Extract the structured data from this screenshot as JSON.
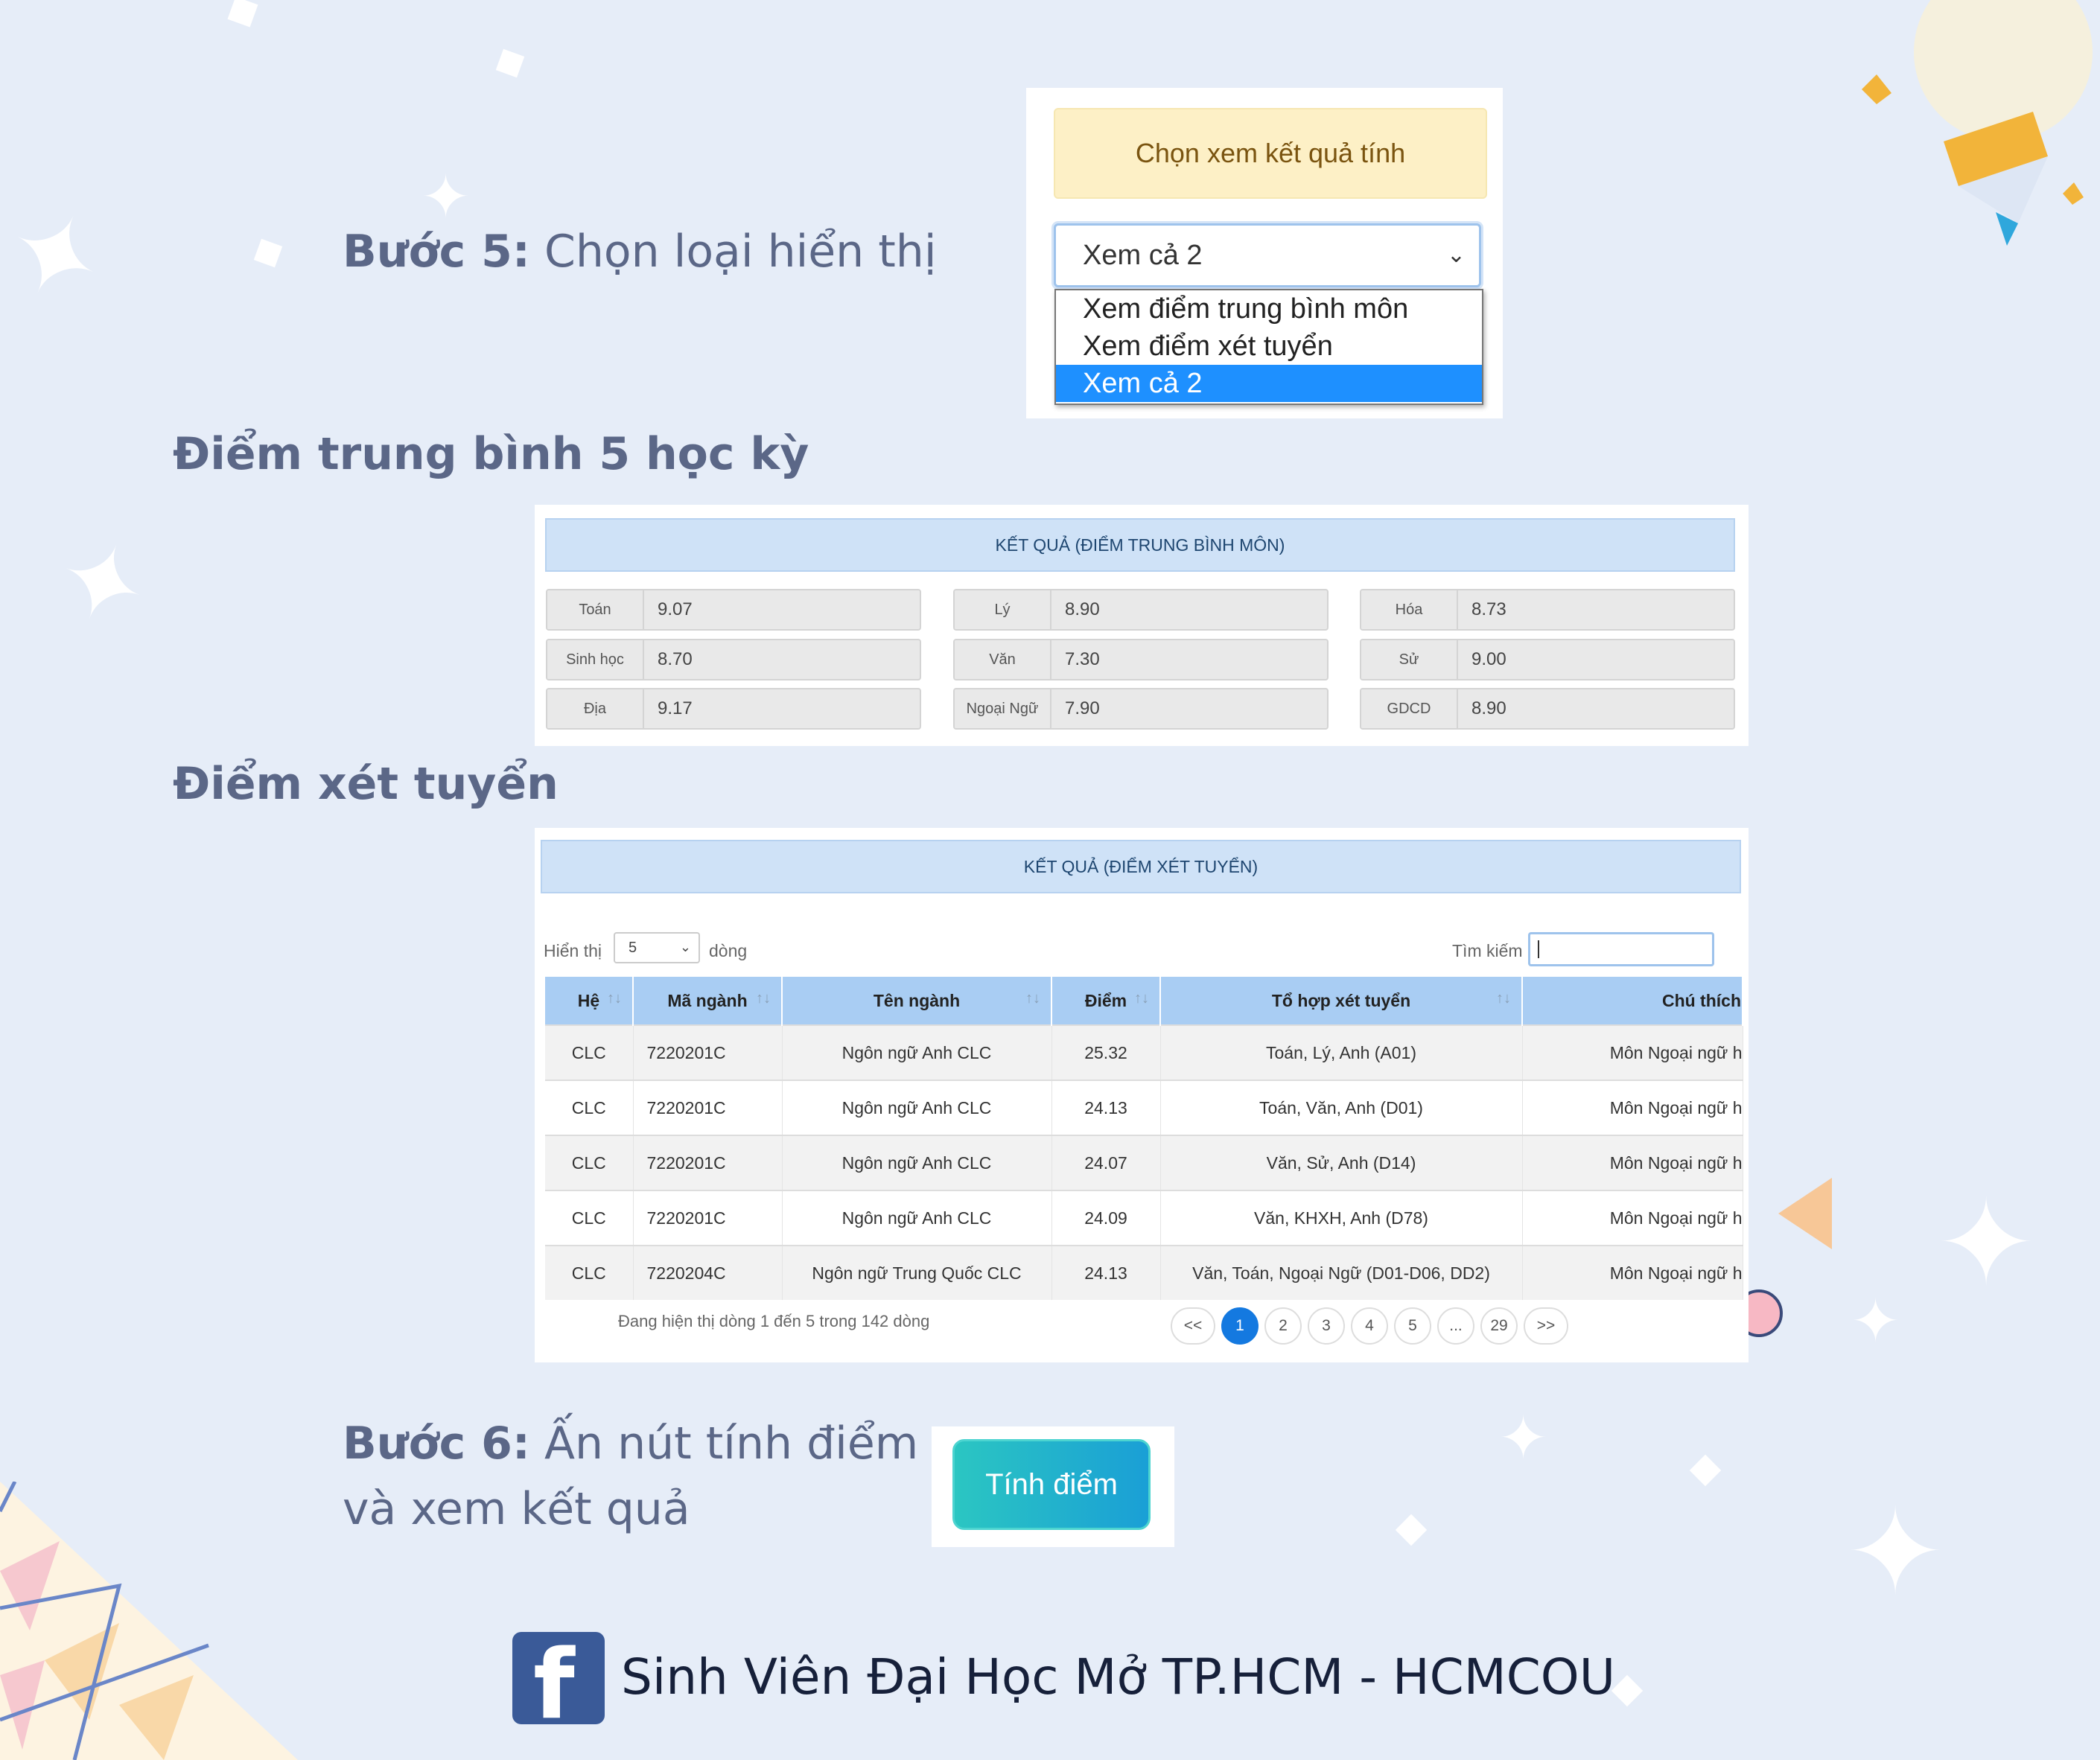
{
  "step5": {
    "label_bold": "Bước 5:",
    "label_rest": " Chọn loại hiển thị",
    "choose_button": "Chọn xem kết quả tính",
    "select_value": "Xem cả 2",
    "options": [
      "Xem điểm trung bình môn",
      "Xem điểm xét tuyển",
      "Xem cả 2"
    ]
  },
  "gpa": {
    "section_title": "Điểm trung bình 5 học kỳ",
    "header": "KẾT QUẢ (ĐIỂM TRUNG BÌNH MÔN)",
    "cells": [
      {
        "label": "Toán",
        "value": "9.07"
      },
      {
        "label": "Lý",
        "value": "8.90"
      },
      {
        "label": "Hóa",
        "value": "8.73"
      },
      {
        "label": "Sinh học",
        "value": "8.70"
      },
      {
        "label": "Văn",
        "value": "7.30"
      },
      {
        "label": "Sử",
        "value": "9.00"
      },
      {
        "label": "Địa",
        "value": "9.17"
      },
      {
        "label": "Ngoại Ngữ",
        "value": "7.90"
      },
      {
        "label": "GDCD",
        "value": "8.90"
      }
    ]
  },
  "admission": {
    "section_title": "Điểm xét tuyển",
    "header": "KẾT QUẢ (ĐIỂM XÉT TUYỂN)",
    "show_label": "Hiển thị",
    "page_length": "5",
    "rows_label": "dòng",
    "search_label": "Tìm kiếm",
    "search_value": "",
    "columns": [
      "Hệ",
      "Mã ngành",
      "Tên ngành",
      "Điểm",
      "Tổ hợp xét tuyển",
      "Chú thích"
    ],
    "rows": [
      [
        "CLC",
        "7220201C",
        "Ngôn ngữ Anh CLC",
        "25.32",
        "Toán, Lý, Anh (A01)",
        "Môn Ngoại ngữ h"
      ],
      [
        "CLC",
        "7220201C",
        "Ngôn ngữ Anh CLC",
        "24.13",
        "Toán, Văn, Anh (D01)",
        "Môn Ngoại ngữ h"
      ],
      [
        "CLC",
        "7220201C",
        "Ngôn ngữ Anh CLC",
        "24.07",
        "Văn, Sử, Anh (D14)",
        "Môn Ngoại ngữ h"
      ],
      [
        "CLC",
        "7220201C",
        "Ngôn ngữ Anh CLC",
        "24.09",
        "Văn, KHXH, Anh (D78)",
        "Môn Ngoại ngữ h"
      ],
      [
        "CLC",
        "7220204C",
        "Ngôn ngữ Trung Quốc CLC",
        "24.13",
        "Văn, Toán, Ngoại Ngữ (D01-D06, DD2)",
        "Môn Ngoại ngữ h"
      ]
    ],
    "info": "Đang hiện thị dòng 1 đến 5 trong 142 dòng",
    "pagination": [
      "<<",
      "1",
      "2",
      "3",
      "4",
      "5",
      "...",
      "29",
      ">>"
    ],
    "active_page": "1"
  },
  "step6": {
    "label_bold": "Bước 6:",
    "label_rest": " Ấn nút tính điểm",
    "label_line2": "và xem kết quả",
    "button": "Tính điểm"
  },
  "footer": {
    "text": "Sinh Viên Đại Học Mở TP.HCM - HCMCOU"
  },
  "colors": {
    "background": "#e6edf8",
    "header_bar": "#cfe2f7",
    "table_header": "#a9cdf3",
    "active_page": "#1479e0",
    "dropdown_selected": "#1e90ff",
    "calc_button": "#1fb3cf",
    "facebook": "#3a5a98"
  }
}
